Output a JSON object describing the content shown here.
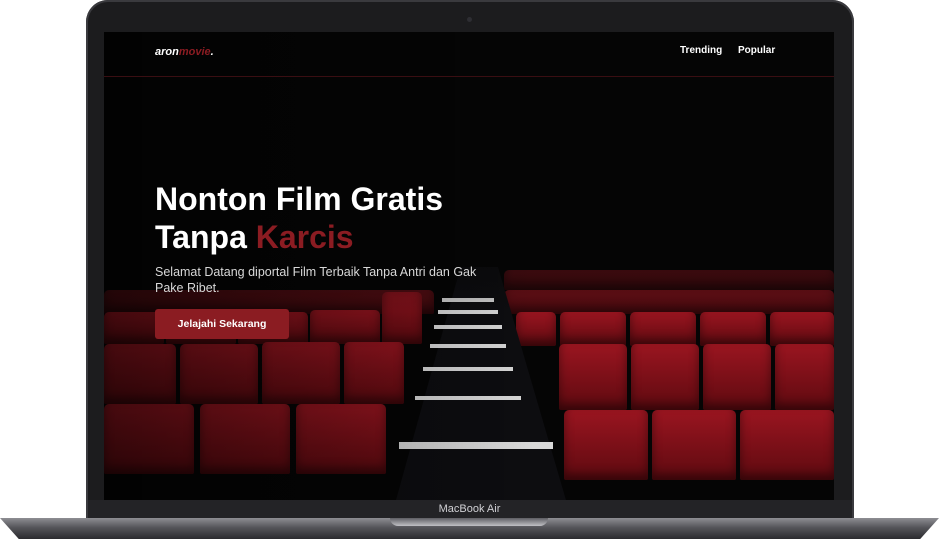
{
  "site": {
    "logo_main": "aron",
    "logo_accent": "movie",
    "logo_dot": "."
  },
  "nav": {
    "items": [
      {
        "label": "Trending"
      },
      {
        "label": "Popular"
      }
    ]
  },
  "hero": {
    "title_line1": "Nonton Film Gratis",
    "title_line2_prefix": "Tanpa ",
    "title_line2_accent": "Karcis",
    "subtitle": "Selamat Datang diportal Film Terbaik Tanpa Antri dan Gak Pake Ribet.",
    "cta_label": "Jelajahi Sekarang"
  },
  "device": {
    "label": "MacBook Air"
  },
  "colors": {
    "accent": "#8b1c22",
    "background": "#050505",
    "seat": "#9a1520"
  }
}
